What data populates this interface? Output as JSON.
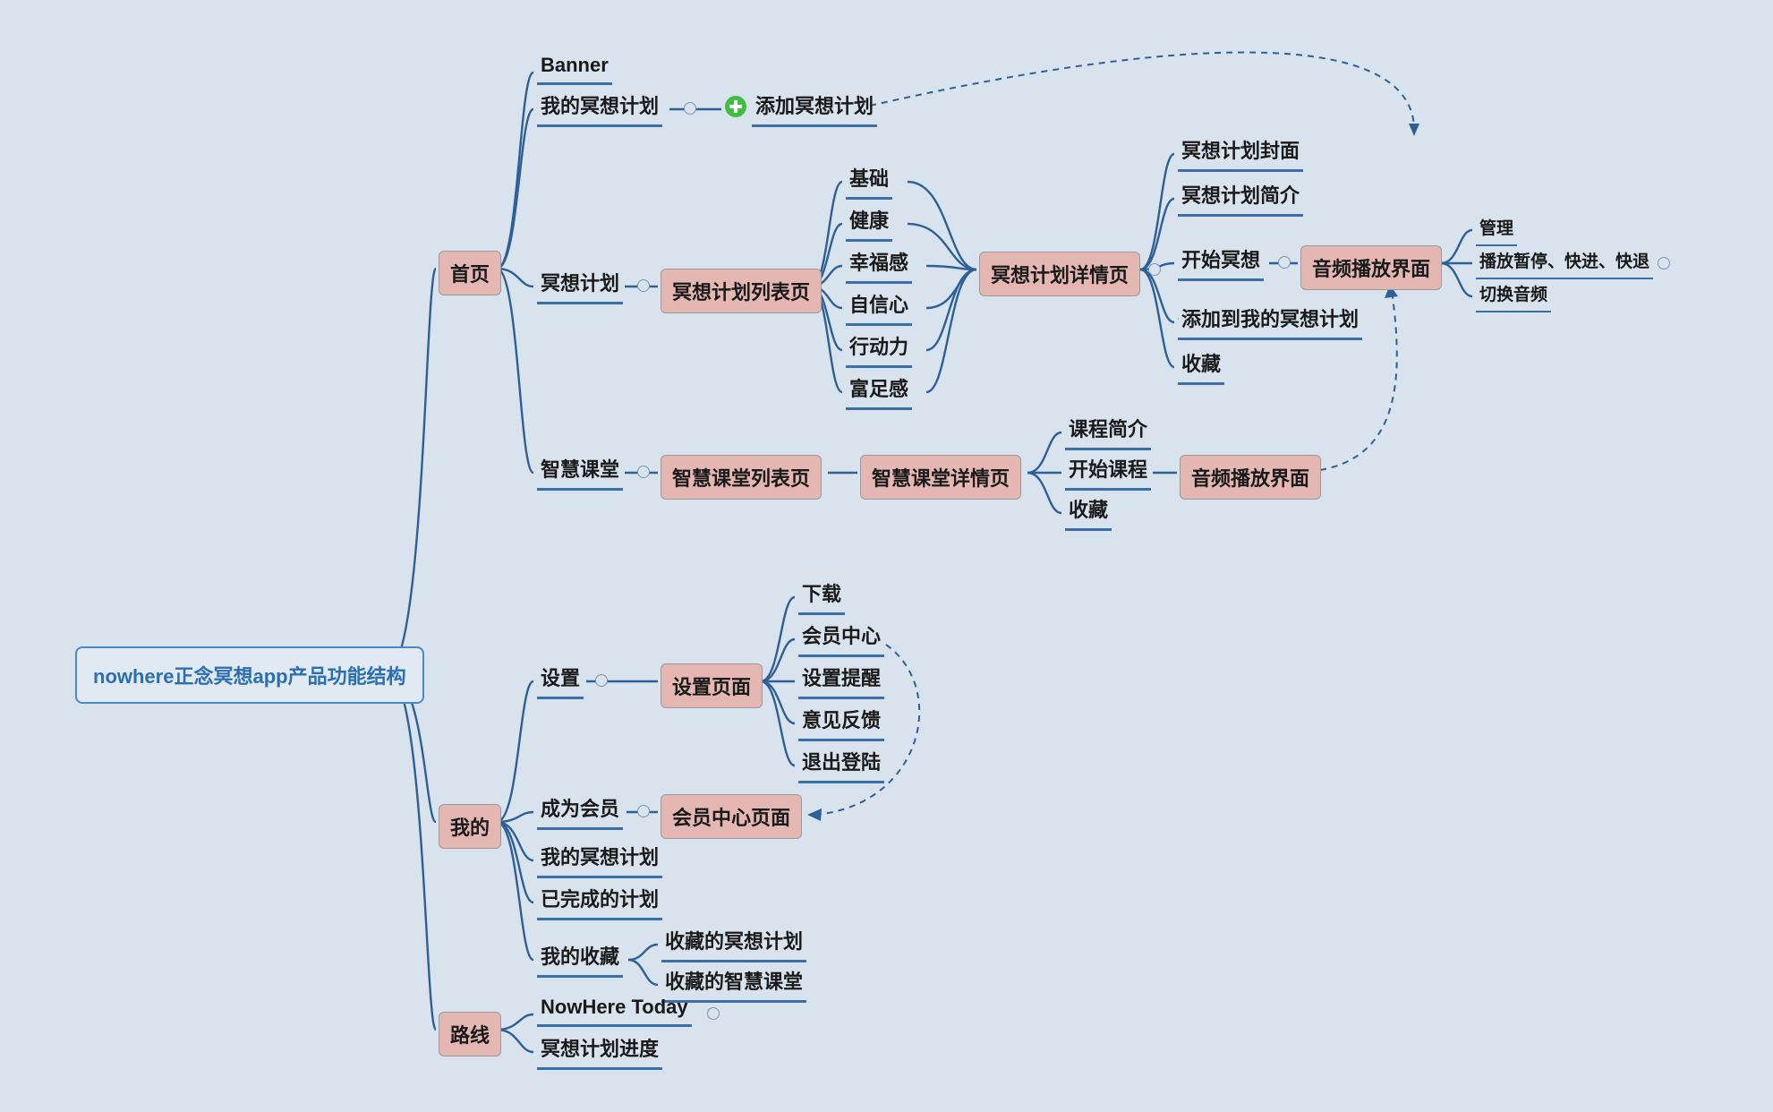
{
  "root": {
    "title": "nowhere正念冥想app产品功能结构"
  },
  "home": {
    "label": "首页",
    "banner": "Banner",
    "my_plan": "我的冥想计划",
    "add_plan": "添加冥想计划",
    "plan": {
      "label": "冥想计划",
      "list": "冥想计划列表页",
      "categories": [
        "基础",
        "健康",
        "幸福感",
        "自信心",
        "行动力",
        "富足感"
      ],
      "detail": {
        "label": "冥想计划详情页",
        "children": [
          "冥想计划封面",
          "冥想计划简介",
          "开始冥想",
          "添加到我的冥想计划",
          "收藏"
        ]
      },
      "audio": {
        "label": "音频播放界面",
        "children": [
          "管理",
          "播放暂停、快进、快退",
          "切换音频"
        ]
      }
    },
    "class": {
      "label": "智慧课堂",
      "list": "智慧课堂列表页",
      "detail": "智慧课堂详情页",
      "detail_children": [
        "课程简介",
        "开始课程",
        "收藏"
      ],
      "audio": "音频播放界面"
    }
  },
  "mine": {
    "label": "我的",
    "settings": {
      "label": "设置",
      "page": "设置页面",
      "children": [
        "下载",
        "会员中心",
        "设置提醒",
        "意见反馈",
        "退出登陆"
      ]
    },
    "vip": {
      "label": "成为会员",
      "page": "会员中心页面"
    },
    "my_plan": "我的冥想计划",
    "done_plan": "已完成的计划",
    "fav": {
      "label": "我的收藏",
      "children": [
        "收藏的冥想计划",
        "收藏的智慧课堂"
      ]
    }
  },
  "route": {
    "label": "路线",
    "children": [
      "NowHere Today",
      "冥想计划进度"
    ]
  }
}
